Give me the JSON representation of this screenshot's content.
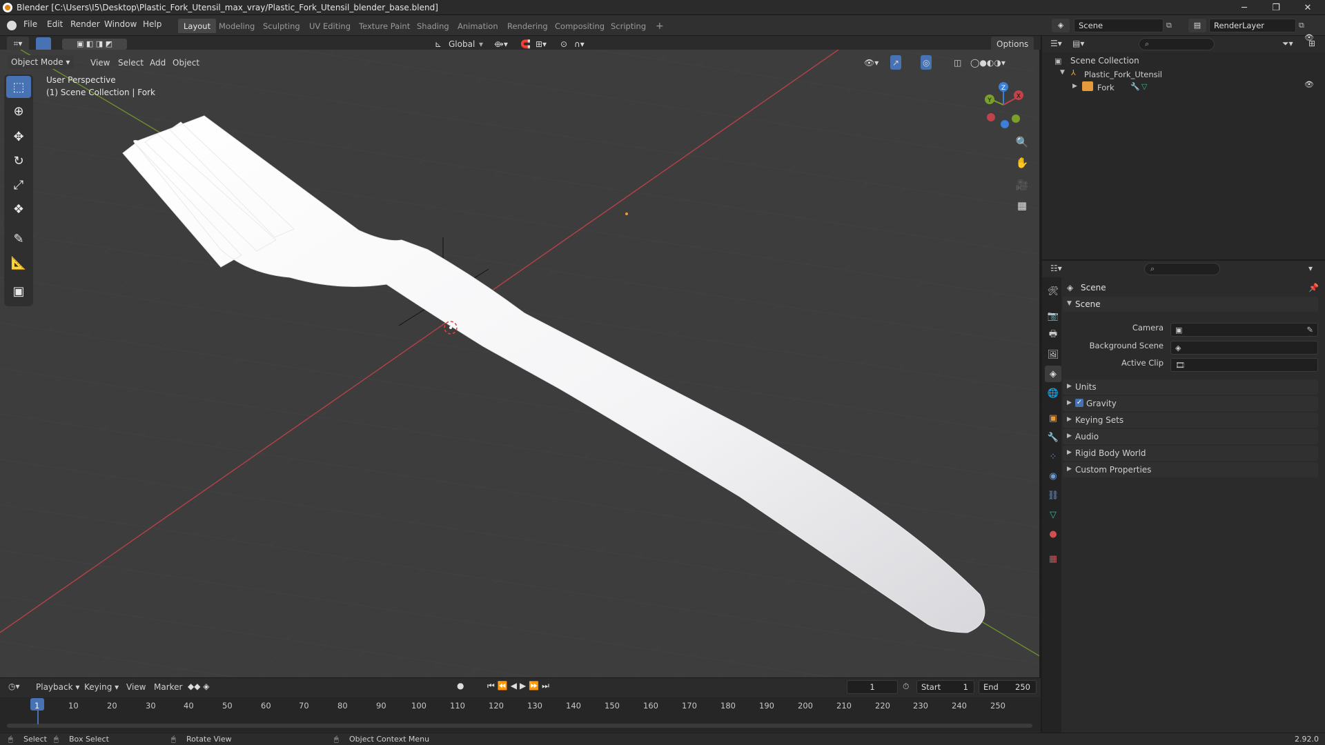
{
  "window": {
    "title": "Blender [C:\\Users\\I5\\Desktop\\Plastic_Fork_Utensil_max_vray/Plastic_Fork_Utensil_blender_base.blend]",
    "minimize": "─",
    "maximize": "❐",
    "close": "✕"
  },
  "menu": [
    "File",
    "Edit",
    "Render",
    "Window",
    "Help"
  ],
  "workspaces": [
    "Layout",
    "Modeling",
    "Sculpting",
    "UV Editing",
    "Texture Paint",
    "Shading",
    "Animation",
    "Rendering",
    "Compositing",
    "Scripting"
  ],
  "workspace_add": "+",
  "scene": {
    "name": "Scene",
    "render_layer": "RenderLayer"
  },
  "viewport": {
    "mode": "Object Mode",
    "view": "View",
    "select": "Select",
    "add": "Add",
    "object": "Object",
    "orientation": "Global",
    "options": "Options",
    "perspective": "User Perspective",
    "collection_info": "(1) Scene Collection | Fork",
    "gizmo": {
      "z": "Z",
      "y": "Y",
      "x": "X"
    }
  },
  "outliner": {
    "root": "Scene Collection",
    "collection": "Plastic_Fork_Utensil",
    "object": "Fork"
  },
  "properties": {
    "header": "Scene",
    "panel": "Scene",
    "fields": [
      {
        "label": "Camera"
      },
      {
        "label": "Background Scene"
      },
      {
        "label": "Active Clip"
      }
    ],
    "sections": [
      "Units",
      "Gravity",
      "Keying Sets",
      "Audio",
      "Rigid Body World",
      "Custom Properties"
    ],
    "gravity_checked": true
  },
  "timeline": {
    "playback": "Playback",
    "keying": "Keying",
    "view": "View",
    "marker": "Marker",
    "current_frame": "1",
    "start_label": "Start",
    "start": "1",
    "end_label": "End",
    "end": "250",
    "ticks": [
      "1",
      "10",
      "20",
      "30",
      "40",
      "50",
      "60",
      "70",
      "80",
      "90",
      "100",
      "110",
      "120",
      "130",
      "140",
      "150",
      "160",
      "170",
      "180",
      "190",
      "200",
      "210",
      "220",
      "230",
      "240",
      "250"
    ]
  },
  "status": {
    "select": "Select",
    "box_select": "Box Select",
    "rotate": "Rotate View",
    "context": "Object Context Menu",
    "version": "2.92.0"
  },
  "colors": {
    "accent": "#4772b3",
    "x_axis": "#c0424b",
    "y_axis": "#7aa02c",
    "z_axis": "#3b7fd6",
    "viewport_bg": "#3d3d3d"
  }
}
